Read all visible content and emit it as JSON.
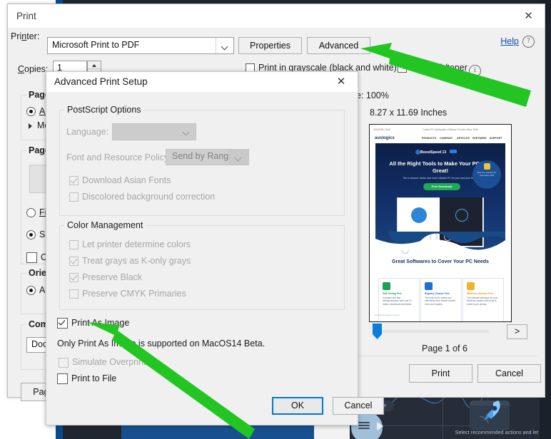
{
  "print_dialog": {
    "title": "Print",
    "close_icon": "close-icon",
    "printer_label": "Printer:",
    "printer_value": "Microsoft Print to PDF",
    "properties_button": "Properties",
    "advanced_button": "Advanced",
    "help_link": "Help",
    "help_icon": "question-mark-icon",
    "copies_label": "Copies:",
    "copies_value": "1",
    "grayscale_checkbox": "Print in grayscale (black and white)",
    "save_ink_checkbox": "Save ink/toner",
    "info_icon": "info-icon",
    "pages_group": "Pages to",
    "pages_all": "All",
    "pages_more": "More",
    "page_size_group": "Page Siz",
    "fit_radio": "Fit",
    "shrink_radio": "Shrin",
    "choose_checkbox": "Choo",
    "orientation_group": "Orientat",
    "orientation_auto": "Auto",
    "comments_group": "Comme",
    "comments_value": "Docum",
    "page_setup_button": "Page Set",
    "scale_text": "e: 100%",
    "paper_size_text": "8.27 x 11.69 Inches",
    "next_page_button": ">",
    "page_indicator": "Page 1 of 6",
    "print_button": "Print",
    "cancel_button": "Cancel"
  },
  "advanced_dialog": {
    "title": "Advanced Print Setup",
    "close_icon": "close-icon",
    "postscript_group": "PostScript Options",
    "language_label": "Language:",
    "language_value": "",
    "font_policy_label": "Font and Resource Policy:",
    "font_policy_value": "Send by Range",
    "download_asian_fonts": "Download Asian Fonts",
    "discolored_background": "Discolored background correction",
    "color_group": "Color Management",
    "let_printer": "Let printer determine colors",
    "treat_grays": "Treat grays as K-only grays",
    "preserve_black": "Preserve Black",
    "preserve_cmyk": "Preserve CMYK Primaries",
    "print_as_image": "Print As Image",
    "note": "Only Print As Image is supported on MacOS14 Beta.",
    "simulate_overprinting": "Simulate Overprinting",
    "print_to_file": "Print to File",
    "ok_button": "OK",
    "cancel_button": "Cancel"
  },
  "preview": {
    "stamp_left": "2024/5/28, 18:36",
    "stamp_right": "Trusted PC Optimization Software Provider Since 2008",
    "brand": "auslogics",
    "nav": [
      "PRODUCTS",
      "COMPANY",
      "ARTICLES",
      "PARTNERS",
      "SUPPORT"
    ],
    "chip": "BoostSpeed 13",
    "chip_badge": "NEW",
    "headline": "All the Right Tools to Make Your PC Run Great!",
    "subtext": "Get a cleaner, faster and more reliable PC for you and your family",
    "cta": "Free Download",
    "award_text": "Best Free Software PC optimization 2023",
    "section_title": "Great Softwares to Cover Your PC Needs",
    "cards": [
      {
        "title": "Disk Defrag Free",
        "desc": "Compact and fast defragmentation with over 31 million downloads worldwide.",
        "color": "#1aa053"
      },
      {
        "title": "Registry Cleaner Free",
        "desc": "The best tool to safely and effectively clear broken entries from your registry.",
        "color": "#1f6fd0"
      },
      {
        "title": "Windows Slimmer Free",
        "desc": "The ultimate slimdown for your Windows system with tools to protect your privacy.",
        "color": "#f0b429"
      }
    ],
    "footer": "https://www.auslogics.com/en/"
  },
  "background_app": {
    "resume_pill": "resume",
    "rocket_caption": "Select recommended actions and let"
  },
  "annotations": {
    "arrow_color": "#22c522",
    "arrow1_target": "advanced-button",
    "arrow2_target": "print-as-image-checkbox"
  }
}
